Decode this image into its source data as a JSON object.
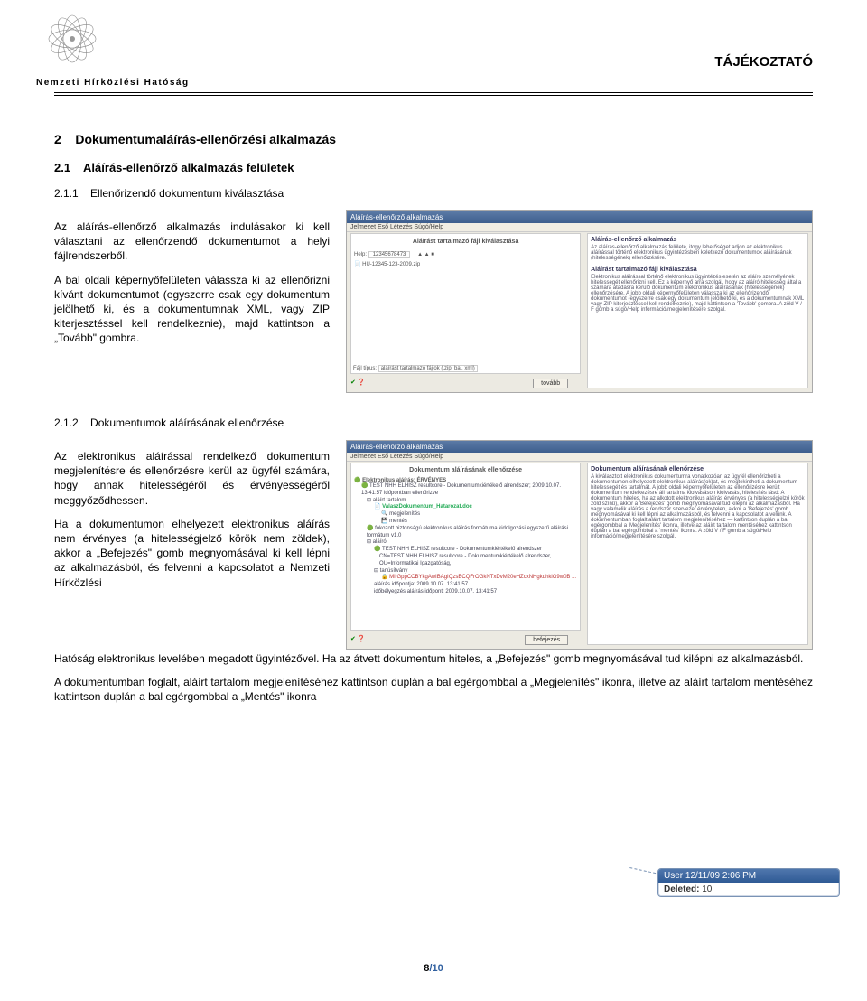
{
  "header": {
    "agency": "Nemzeti Hírközlési Hatóság",
    "doc_type": "TÁJÉKOZTATÓ"
  },
  "sections": {
    "s2_num": "2",
    "s2_title": "Dokumentumaláírás-ellenőrzési alkalmazás",
    "s21_num": "2.1",
    "s21_title": "Aláírás-ellenőrző alkalmazás felületek",
    "s211_num": "2.1.1",
    "s211_title": "Ellenőrizendő dokumentum kiválasztása",
    "s212_num": "2.1.2",
    "s212_title": "Dokumentumok aláírásának ellenőrzése"
  },
  "para": {
    "p1": "Az aláírás-ellenőrző alkalmazás indulásakor ki kell választani az ellenőrzendő dokumentumot a helyi fájlrendszerből.",
    "p2": "A bal oldali képernyőfelületen válassza ki az ellenőrizni kívánt dokumentumot (egyszerre csak egy dokumentum jelölhető ki, és a dokumentumnak XML, vagy ZIP kiterjesztéssel kell rendelkeznie), majd kattintson a „Tovább\" gombra.",
    "p3": "Az elektronikus aláírással rendelkező dokumentum megjelenítésre és ellenőrzésre kerül az ügyfél számára, hogy annak hitelességéről és érvényességéről meggyőződhessen.",
    "p4": "Ha a dokumentumon elhelyezett elektronikus aláírás nem érvényes (a hitelességjelző körök nem zöldek), akkor a „Befejezés\" gomb megnyomásával ki kell lépni az alkalmazásból, és felvenni a kapcsolatot a Nemzeti Hírközlési",
    "p5": "Hatóság elektronikus levelében megadott ügyintézővel. Ha az átvett dokumentum hiteles, a „Befejezés\" gomb megnyomásával tud kilépni az alkalmazásból.",
    "p6": "A dokumentumban foglalt, aláírt tartalom megjelenítéséhez kattintson duplán a bal egérgombbal a „Megjelenítés\" ikonra, illetve az aláírt tartalom mentéséhez kattintson duplán a bal egérgombbal a „Mentés\" ikonra"
  },
  "shot1": {
    "title": "Aláírás-ellenőrző alkalmazás",
    "menu": "Jelmezet  Eső  Létezés  Súgó/Help",
    "panel_title": "Aláírást tartalmazó fájl kiválasztása",
    "right_head": "Aláírás-ellenőrző alkalmazás",
    "right_body1": "Az aláírás-ellenőrző alkalmazás felülete, itogy lehetőséget adjon az elektronikus aláírással történő elektronikus ügyintézésben keletkező dokumentumok aláírásának (hitelességének) ellenőrzésére.",
    "right_head2": "Aláírást tartalmazó fájl kiválasztása",
    "right_body2": "Elektronikus aláírással történő elektronikus ügyintézés esetén az aláíró személyének hitelességét ellenőrizni kell. Ez a képernyő arra szolgál, hogy az aláíró hitelesség által a számára átadásra kerülő dokumentum elektronikus aláírásának (hitelességének) ellenőrzésére. A jobb oldali képernyőfelületen válassza ki az ellenőrizendő dokumentumot (egyszerre csak egy dokumentum jelölhető ki, és a dokumentumnak XML vagy ZIP kiterjesztéssel kell rendelkeznie), majd kattintson a 'Tovább' gombra. A zöld V / F gomb a súgó/Help információ/megjelenítésére szolgál.",
    "filetype_lbl": "Fájl típus:",
    "filetype_val": "aláírást tartalmazó fájlok (.zip, bal, xml)",
    "btn_next": "tovább",
    "help_lbl": "Help:",
    "help_val": "12345678473",
    "file1": "HU-12345-123-2009.zip"
  },
  "shot2": {
    "title": "Aláírás-ellenőrző alkalmazás",
    "menu": "Jelmezet  Eső  Létezés  Súgó/Help",
    "panel_title": "Dokumentum aláírásának ellenőrzése",
    "status": "Elektronikus aláírás: ÉRVÉNYES",
    "line1": "TEST NHH ELHISZ resultcore - Dokumentumkiértékelő alrendszer; 2009.10.07. 13:41:57 időpontban ellenőrizve",
    "tree1": "aláírt tartalom",
    "tree2": "ValaszDokumentum_Hatarozat.doc",
    "tree3": "megjelenítés",
    "tree4": "mentés",
    "tree5": "fokozott biztonságú elektronikus aláírás formátuma kidolgozási egyszerű aláírási formátum v1.0",
    "tree6": "aláíró",
    "tree7": "TEST NHH ELHISZ resultcore - Dokumentumkiértékelő alrendszer",
    "tree8": "CN=TEST NHH ELHISZ resultcore - Dokumentumkiértékelő alrendszer, OU=Informatikai Igazgatóság,",
    "tree9": "tanúsítvány",
    "tree10": "MIIGppCCBYkgAwIBAgIQzsBCQFrOGkNTxDvM20eHZcxNHgkqhkiG9w0B ...",
    "tree11": "aláírás időpontja: 2009.10.07. 13:41:57",
    "tree12": "időbélyegzés aláírás időpont: 2009.10.07. 13:41:57",
    "right_head": "Dokumentum aláírásának ellenőrzése",
    "right_body": "A kiválasztott elektronikus dokumentumra vonatkozóan az ügyfél ellenőrizheti a dokumentumon elhelyezett elektronikus aláírás(ok)at, és megtekintheti a dokumentum hitelességét és tartalmát. A jobb oldali képernyőfelületen az ellenőrizésre került dokumentum rendelkezésre áll tartalma kiolvasáson kiolvasás, hitelesítés lásd: A dokumentum hiteles, ha az alkotott elektronikus aláírás érvényes (a hitelességjelző körök zöld színű), akkor a 'Befejezés' gomb megnyomásával tud kilépni az alkalmazásból. Ha vagy valamelik aláírás a rendszer szervezet érvénytelen, akkor a 'Befejezés' gomb megnyomásával ki kell lépni az alkalmazásból, és felvenni a kapcsolatot a velünk. A dokumentumban foglalt aláírt tartalom megjelenítéséhez — kattintson duplán a bal egérgombbal a 'Megjelenítés' ikonra, illetve az aláírt tartalom mentéséhez kattintson duplán a bal egérgombbal a 'mentés' ikonra. A zöld V / F gomb a súgó/Help információ/megjelenítésére szolgál.",
    "btn_done": "befejezés"
  },
  "comment": {
    "header": "User 12/11/09 2:06 PM",
    "body": "Deleted: 10"
  },
  "footer": {
    "page": "8/10"
  }
}
